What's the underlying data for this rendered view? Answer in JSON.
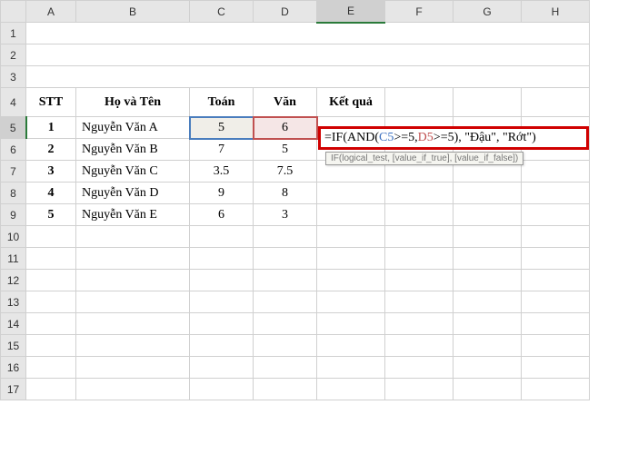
{
  "columns": [
    "A",
    "B",
    "C",
    "D",
    "E",
    "F",
    "G",
    "H"
  ],
  "row_count": 17,
  "active_col": "E",
  "active_row": 5,
  "headers": {
    "row": 4,
    "stt": "STT",
    "name": "Họ và Tên",
    "math": "Toán",
    "lit": "Văn",
    "result": "Kết quả"
  },
  "rows": [
    {
      "stt": "1",
      "name": "Nguyễn Văn A",
      "math": "5",
      "lit": "6"
    },
    {
      "stt": "2",
      "name": "Nguyễn Văn B",
      "math": "7",
      "lit": "5"
    },
    {
      "stt": "3",
      "name": "Nguyễn Văn C",
      "math": "3.5",
      "lit": "7.5"
    },
    {
      "stt": "4",
      "name": "Nguyễn Văn D",
      "math": "9",
      "lit": "8"
    },
    {
      "stt": "5",
      "name": "Nguyễn Văn E",
      "math": "6",
      "lit": "3"
    }
  ],
  "editing": {
    "cell": "E5",
    "formula_parts": [
      {
        "t": "=IF(",
        "c": "black"
      },
      {
        "t": "AND",
        "c": "black"
      },
      {
        "t": "(",
        "c": "black"
      },
      {
        "t": "C5",
        "c": "blue"
      },
      {
        "t": ">=5, ",
        "c": "black"
      },
      {
        "t": "D5",
        "c": "red"
      },
      {
        "t": ">=5), \"Đậu\", \"Rớt\")",
        "c": "black"
      }
    ],
    "hint": "IF(logical_test, [value_if_true], [value_if_false])"
  },
  "ref_highlight": {
    "blue": "C5",
    "red": "D5"
  }
}
